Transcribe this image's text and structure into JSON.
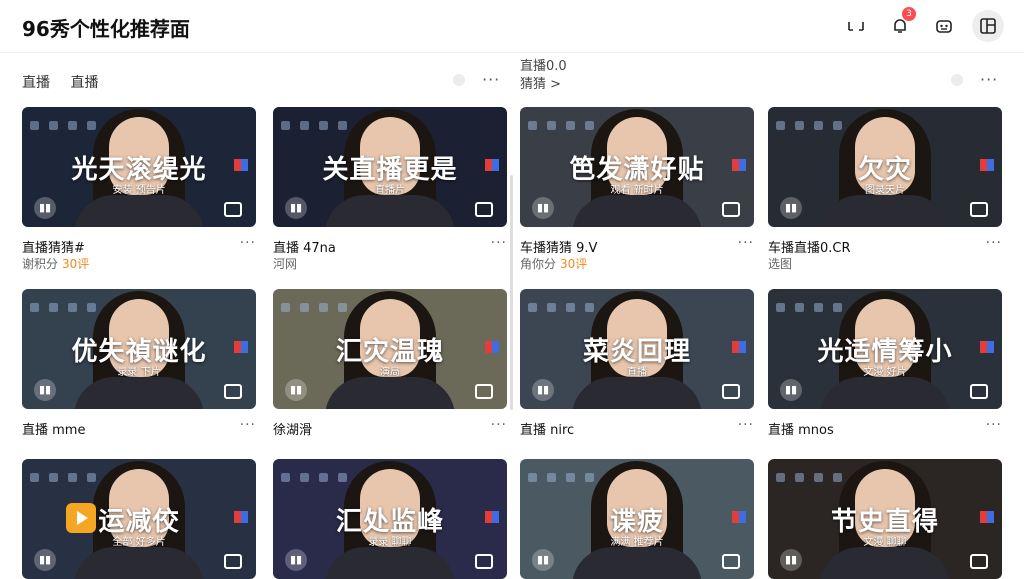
{
  "header": {
    "title": "96秀个性化推荐面",
    "notification_count": "3",
    "icons": [
      "cast-icon",
      "bell-icon",
      "robot-icon",
      "layout-icon"
    ]
  },
  "sections": {
    "left_head": [
      "直播",
      "直播"
    ],
    "right_head_title": "直播0.0",
    "right_head_sub": "猜猜 >",
    "more": "···"
  },
  "cards": [
    {
      "overlay": "光天滚缇光",
      "overlay_sub": "安装  预告片",
      "title": "直播猜猜#",
      "meta": "谢积分",
      "hot": "30评",
      "bg": "#1d2638"
    },
    {
      "overlay": "关直播更是",
      "overlay_sub": "直播片",
      "title": "直播 47na",
      "meta": "河网",
      "hot": "",
      "bg": "#1b2133"
    },
    {
      "overlay": "笆发潇好贴",
      "overlay_sub": "观看 新时片",
      "title": "车播猜猜 9.V",
      "meta": "角你分",
      "hot": "30评",
      "bg": "#3a3f47"
    },
    {
      "overlay": "欠灾",
      "overlay_sub": "图录天片",
      "title": "车播直播0.CR",
      "meta": "选图",
      "hot": "",
      "bg": "#272b33"
    },
    {
      "overlay": "优失禎谜化",
      "overlay_sub": "录录  下片",
      "title": "直播 mme",
      "meta": "",
      "hot": "",
      "bg": "#34414f"
    },
    {
      "overlay": "汇灾温瑰",
      "overlay_sub": "演局",
      "title": "徐湖滑",
      "meta": "",
      "hot": "",
      "bg": "#6b6a58"
    },
    {
      "overlay": "菜炎回理",
      "overlay_sub": "直播",
      "title": "直播 nirc",
      "meta": "",
      "hot": "",
      "bg": "#3c4652"
    },
    {
      "overlay": "光适情筹小",
      "overlay_sub": "文漫 好片",
      "title": "直播 mnos",
      "meta": "",
      "hot": "",
      "bg": "#2b313a"
    },
    {
      "overlay": "运减佼",
      "overlay_sub": "全部  好多片",
      "title": "",
      "meta": "",
      "hot": "",
      "bg": "#283044"
    },
    {
      "overlay": "汇处监峰",
      "overlay_sub": "录录 聊聊",
      "title": "",
      "meta": "",
      "hot": "",
      "bg": "#2a2a4a"
    },
    {
      "overlay": "谍疲",
      "overlay_sub": "满满 推荐片",
      "title": "",
      "meta": "",
      "hot": "",
      "bg": "#4b5a62"
    },
    {
      "overlay": "节史直得",
      "overlay_sub": "文漫 聊聊",
      "title": "",
      "meta": "",
      "hot": "",
      "bg": "#2b2623"
    }
  ],
  "colors": {
    "hot": "#f08a24",
    "badge": "#ff4d4f"
  }
}
